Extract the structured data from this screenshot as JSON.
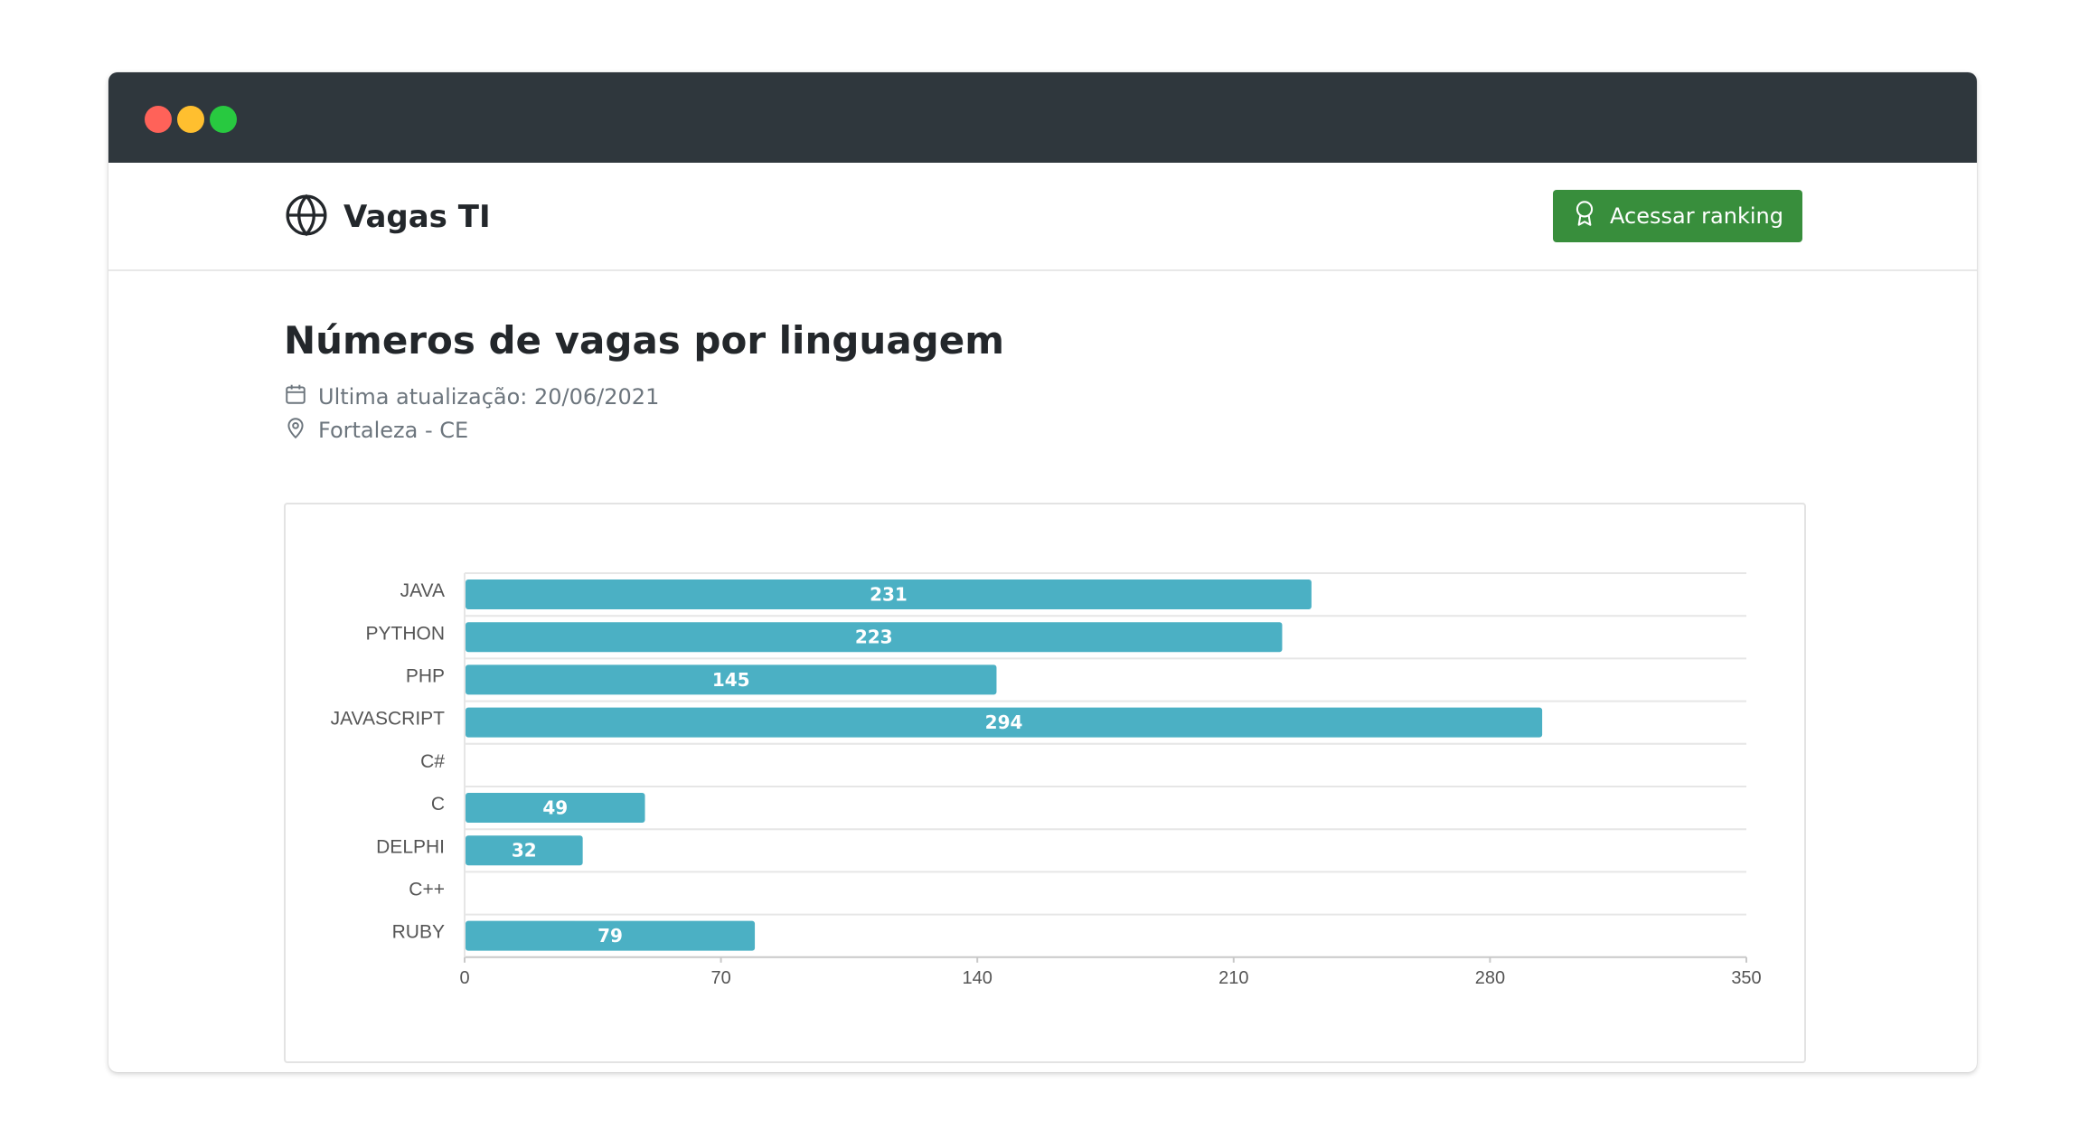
{
  "window": {
    "traffic_lights": [
      "close",
      "minimize",
      "maximize"
    ]
  },
  "navbar": {
    "brand_icon": "globe-icon",
    "brand_name": "Vagas TI",
    "ranking_button": {
      "icon": "award-icon",
      "label": "Acessar ranking",
      "color": "#388e3c"
    }
  },
  "main": {
    "title": "Números de vagas por linguagem",
    "last_update": "Ultima atualização: 20/06/2021",
    "location": "Fortaleza - CE"
  },
  "chart_data": {
    "type": "bar",
    "orientation": "horizontal",
    "categories": [
      "JAVA",
      "PYTHON",
      "PHP",
      "JAVASCRIPT",
      "C#",
      "C",
      "DELPHI",
      "C++",
      "RUBY"
    ],
    "values": [
      231,
      223,
      145,
      294,
      0,
      49,
      32,
      0,
      79
    ],
    "bar_labels": [
      "231",
      "223",
      "145",
      "294",
      "",
      "49",
      "32",
      "",
      "79"
    ],
    "xlim": [
      0,
      350
    ],
    "x_ticks": [
      0,
      70,
      140,
      210,
      280,
      350
    ],
    "grid": true,
    "bar_color": "#4bb0c4"
  }
}
